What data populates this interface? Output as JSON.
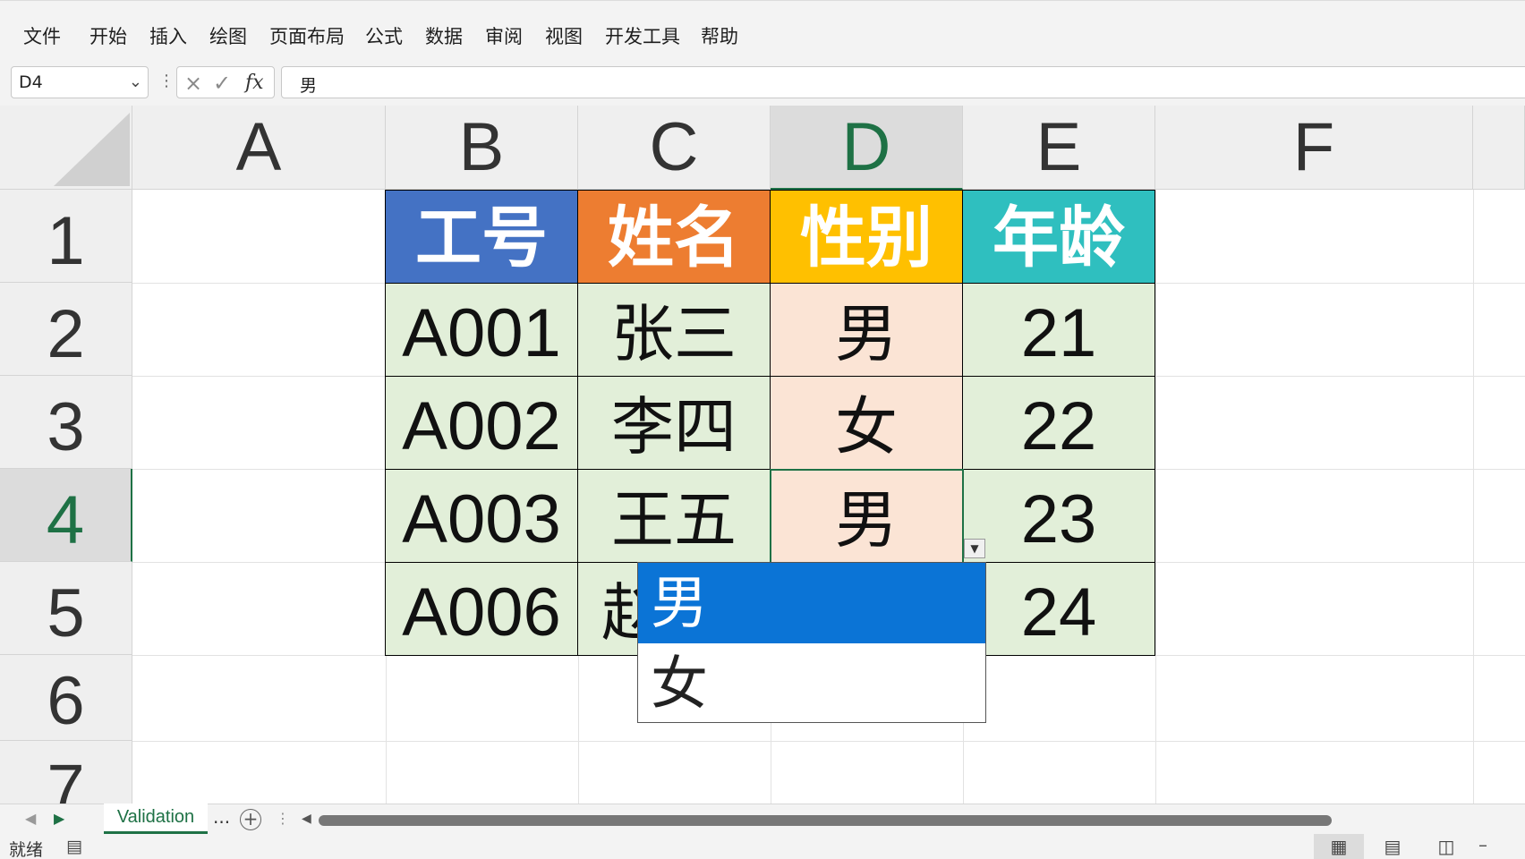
{
  "ribbon": {
    "tabs": [
      "文件",
      "开始",
      "插入",
      "绘图",
      "页面布局",
      "公式",
      "数据",
      "审阅",
      "视图",
      "开发工具",
      "帮助"
    ]
  },
  "formula_bar": {
    "name_box": "D4",
    "dropdown_icon": "chevron-down-icon",
    "cancel_icon": "×",
    "enter_icon": "✓",
    "fx_label": "fx",
    "value": "男"
  },
  "grid": {
    "columns": [
      "A",
      "B",
      "C",
      "D",
      "E",
      "F"
    ],
    "rows": [
      "1",
      "2",
      "3",
      "4",
      "5",
      "6",
      "7"
    ],
    "selected_cell": "D4",
    "table": {
      "headers": [
        "工号",
        "姓名",
        "性别",
        "年龄"
      ],
      "header_colors": [
        "#4472c4",
        "#ed7d31",
        "#ffc000",
        "#2fbfbf"
      ],
      "body_fill": "#e2efd9",
      "gender_fill": "#fbe4d5",
      "rows": [
        [
          "A001",
          "张三",
          "男",
          "21"
        ],
        [
          "A002",
          "李四",
          "女",
          "22"
        ],
        [
          "A003",
          "王五",
          "男",
          "23"
        ],
        [
          "A006",
          "赵",
          "",
          "24"
        ]
      ]
    },
    "dropdown": {
      "options": [
        "男",
        "女"
      ],
      "highlighted_index": 0
    }
  },
  "sheet_tabs": {
    "active": "Validation",
    "more": "...",
    "add_icon": "+"
  },
  "status_bar": {
    "ready": "就绪",
    "view_icons": [
      "normal-view-icon",
      "page-layout-view-icon",
      "page-break-view-icon"
    ],
    "zoom_minus": "–"
  },
  "colors": {
    "accent": "#1e7145",
    "dropdown_highlight": "#0b74d6"
  }
}
